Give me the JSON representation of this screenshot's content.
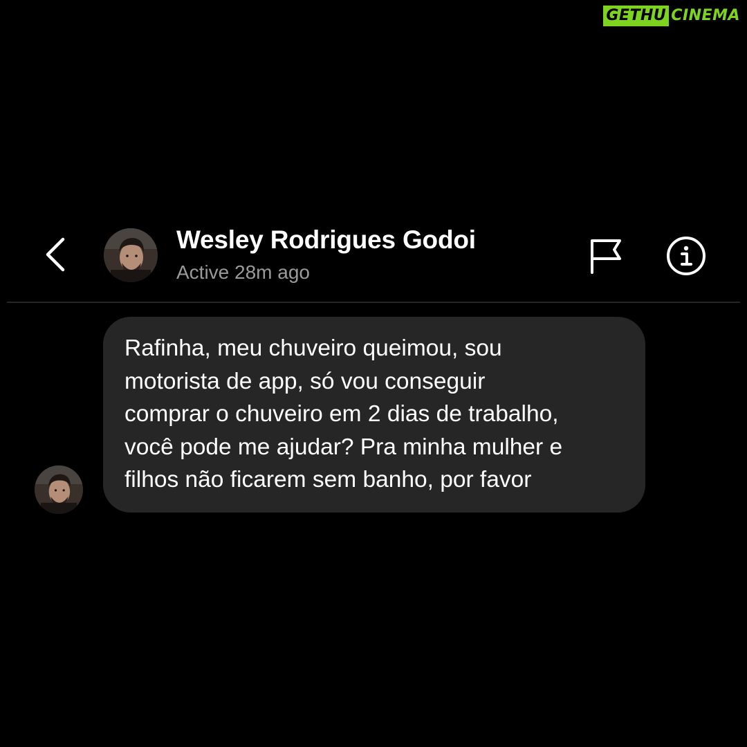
{
  "watermark": {
    "part1": "GETHU",
    "part2": "CINEMA"
  },
  "header": {
    "back_icon": "chevron-left-icon",
    "name": "Wesley Rodrigues Godoi",
    "status": "Active 28m ago",
    "flag_icon": "flag-icon",
    "info_icon": "info-icon"
  },
  "messages": [
    {
      "sender": "Wesley Rodrigues Godoi",
      "direction": "incoming",
      "text": "Rafinha, meu chuveiro queimou, sou\nmotorista de app, só vou conseguir\ncomprar o chuveiro em 2 dias de trabalho,\nvocê pode me ajudar? Pra minha mulher e\nfilhos não ficarem sem banho, por favor"
    }
  ],
  "colors": {
    "background": "#000000",
    "bubble": "#262626",
    "status_text": "#9a9a9a",
    "watermark_green": "#7ed321"
  }
}
